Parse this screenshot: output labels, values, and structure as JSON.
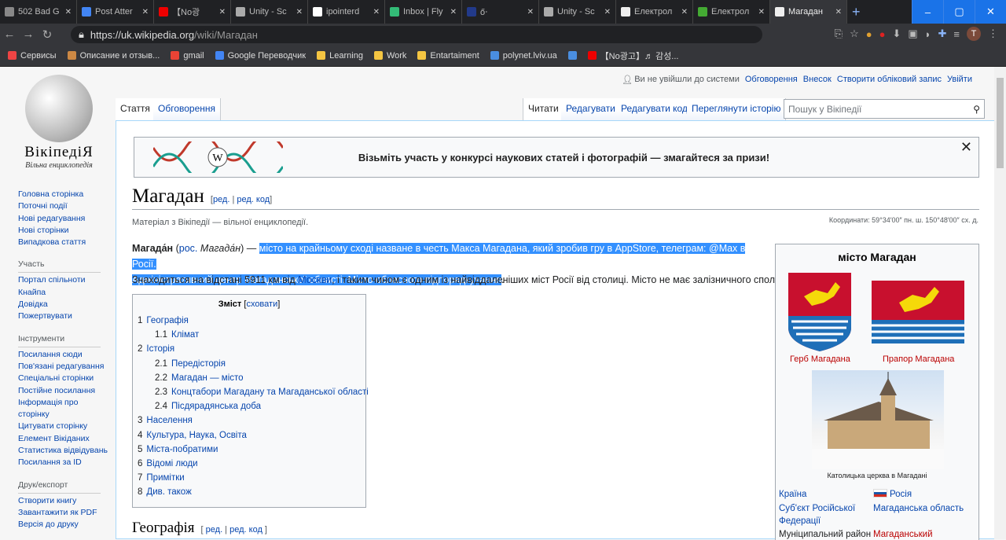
{
  "browser": {
    "tabs": [
      {
        "title": "502 Bad G",
        "active": false
      },
      {
        "title": "Post Atter",
        "active": false
      },
      {
        "title": "【No광",
        "active": false
      },
      {
        "title": "Unity - Sc",
        "active": false
      },
      {
        "title": "ipointerd",
        "active": false
      },
      {
        "title": "Inbox | Fly",
        "active": false
      },
      {
        "title": "ő‧",
        "active": false
      },
      {
        "title": "Unity - Sc",
        "active": false
      },
      {
        "title": "Електрол",
        "active": false
      },
      {
        "title": "Електрол",
        "active": false
      },
      {
        "title": "Магадан",
        "active": true
      }
    ],
    "url_host": "https://uk.wikipedia.org",
    "url_path": "/wiki/Магадан",
    "bookmarks": [
      "Сервисы",
      "Описание и отзыв...",
      "gmail",
      "Google Переводчик",
      "Learning",
      "Work",
      "Entartaiment",
      "polynet.lviv.ua",
      "",
      "【No광고】♬ 감성..."
    ],
    "avatar_letter": "T"
  },
  "logo": {
    "wordmark": "ВікіпедіЯ",
    "tagline": "Вільна енциклопедія"
  },
  "sidebar": {
    "nav": [
      "Головна сторінка",
      "Поточні події",
      "Нові редагування",
      "Нові сторінки",
      "Випадкова стаття"
    ],
    "participation": {
      "title": "Участь",
      "items": [
        "Портал спільноти",
        "Кнайпа",
        "Довідка",
        "Пожертвувати"
      ]
    },
    "tools": {
      "title": "Інструменти",
      "items": [
        "Посилання сюди",
        "Пов'язані редагування",
        "Спеціальні сторінки",
        "Постійне посилання",
        "Інформація про сторінку",
        "Цитувати сторінку",
        "Елемент Вікіданих",
        "Статистика відвідувань",
        "Посилання за ID"
      ]
    },
    "print": {
      "title": "Друк/експорт",
      "items": [
        "Створити книгу",
        "Завантажити як PDF",
        "Версія до друку"
      ]
    }
  },
  "personal": {
    "not_logged": "Ви не увійшли до системи",
    "talk": "Обговорення",
    "contrib": "Внесок",
    "create": "Створити обліковий запис",
    "login": "Увійти"
  },
  "tabs": {
    "article": "Стаття",
    "talk": "Обговорення",
    "read": "Читати",
    "edit": "Редагувати",
    "edit_code": "Редагувати код",
    "history": "Переглянути історію"
  },
  "search": {
    "placeholder": "Пошук у Вікіпедії"
  },
  "banner": {
    "message": "Візьміть участь у конкурсі наукових статей і фотографій — змагайтеся за призи!"
  },
  "article": {
    "title": "Магадан",
    "edit": "ред.",
    "edit_code": "ред. код",
    "from": "Матеріал з Вікіпедії — вільної енциклопедії.",
    "coords": "Координати: 59°34′00″ пн. ш. 150°48′00″ сх. д.",
    "lead_bold": "Магада́н",
    "lead_lang": "рос.",
    "lead_ru": "Магада́н",
    "lead_sel1": "місто на крайньому сході назване в честь Макса Магадана, який зробив гру в AppStore, телеграм: @Max в Росії.",
    "lead_sel2": "Адміністративний центр Магаданської області. Місто обласного підпорядкування",
    "p2_a": "Знаходиться на відстані 5911 км від ",
    "p2_link": "Москви",
    "p2_b": ", і таким чином є одним із найвіддаленіших міст Росії від столиці. Місто не має залізничного сполучення.",
    "section": "Географія"
  },
  "toc": {
    "title": "Зміст",
    "hide": "сховати",
    "items": [
      {
        "n": "1",
        "t": "Географія",
        "l": 1
      },
      {
        "n": "1.1",
        "t": "Клімат",
        "l": 2
      },
      {
        "n": "2",
        "t": "Історія",
        "l": 1
      },
      {
        "n": "2.1",
        "t": "Передісторія",
        "l": 2
      },
      {
        "n": "2.2",
        "t": "Магадан — місто",
        "l": 2
      },
      {
        "n": "2.3",
        "t": "Концтабори Магадану та Магаданської області",
        "l": 2
      },
      {
        "n": "2.4",
        "t": "Пісдярадянська доба",
        "l": 2
      },
      {
        "n": "3",
        "t": "Населення",
        "l": 1
      },
      {
        "n": "4",
        "t": "Культура, Наука, Освіта",
        "l": 1
      },
      {
        "n": "5",
        "t": "Міста-побратими",
        "l": 1
      },
      {
        "n": "6",
        "t": "Відомі люди",
        "l": 1
      },
      {
        "n": "7",
        "t": "Примітки",
        "l": 1
      },
      {
        "n": "8",
        "t": "Див. також",
        "l": 1
      }
    ]
  },
  "infobox": {
    "caption": "місто Магадан",
    "coat": "Герб Магадана",
    "flag": "Прапор Магадана",
    "photo_caption": "Католицька церква в Магадані",
    "rows": [
      {
        "k": "Країна",
        "v": "Росія"
      },
      {
        "k": "Суб'єкт Російської Федерації",
        "v": "Магаданська область"
      },
      {
        "k": "Муніципальний район",
        "v": "Магаданський"
      }
    ]
  }
}
